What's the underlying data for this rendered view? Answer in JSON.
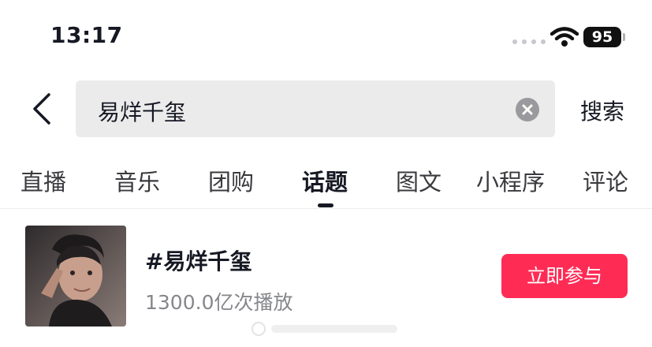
{
  "status_bar": {
    "time": "13:17",
    "battery": "95"
  },
  "search": {
    "query": "易烊千玺",
    "submit_label": "搜索"
  },
  "tabs": [
    {
      "label": "直播"
    },
    {
      "label": "音乐"
    },
    {
      "label": "团购"
    },
    {
      "label": "话题",
      "active": true
    },
    {
      "label": "图文"
    },
    {
      "label": "小程序"
    },
    {
      "label": "评论"
    }
  ],
  "result": {
    "title": "#易烊千玺",
    "play_count": "1300.0亿次播放",
    "join_label": "立即参与"
  },
  "colors": {
    "accent": "#fe2c55",
    "search_bg": "#ebebeb",
    "secondary_text": "#86878b"
  },
  "icons": [
    "signal-dots-icon",
    "wifi-icon",
    "battery-icon",
    "back-arrow-icon",
    "clear-icon"
  ]
}
